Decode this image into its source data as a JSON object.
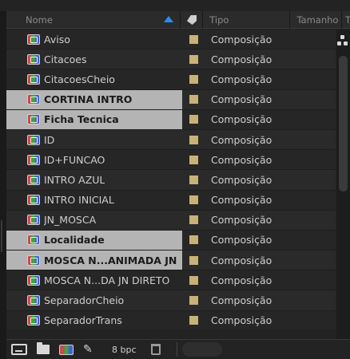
{
  "header": {
    "name_label": "Nome",
    "tipo_label": "Tipo",
    "tamanho_label": "Tamanho",
    "extra_label": "T",
    "sort_direction": "ascending",
    "accent_color": "#2d8ceb"
  },
  "items": [
    {
      "name": "Aviso",
      "type": "Composição",
      "label_color": "#c9b17a",
      "selected": false,
      "bold": false
    },
    {
      "name": "Citacoes",
      "type": "Composição",
      "label_color": "#c9b17a",
      "selected": false,
      "bold": false
    },
    {
      "name": "CitacoesCheio",
      "type": "Composição",
      "label_color": "#c9b17a",
      "selected": false,
      "bold": false
    },
    {
      "name": "CORTINA INTRO",
      "type": "Composição",
      "label_color": "#c9b17a",
      "selected": true,
      "bold": true
    },
    {
      "name": "Ficha Tecnica",
      "type": "Composição",
      "label_color": "#c9b17a",
      "selected": true,
      "bold": true
    },
    {
      "name": "ID",
      "type": "Composição",
      "label_color": "#c9b17a",
      "selected": false,
      "bold": false
    },
    {
      "name": "ID+FUNCAO",
      "type": "Composição",
      "label_color": "#c9b17a",
      "selected": false,
      "bold": false
    },
    {
      "name": "INTRO AZUL",
      "type": "Composição",
      "label_color": "#c9b17a",
      "selected": false,
      "bold": false
    },
    {
      "name": "INTRO INICIAL",
      "type": "Composição",
      "label_color": "#c9b17a",
      "selected": false,
      "bold": false
    },
    {
      "name": "JN_MOSCA",
      "type": "Composição",
      "label_color": "#c9b17a",
      "selected": false,
      "bold": false
    },
    {
      "name": "Localidade",
      "type": "Composição",
      "label_color": "#c9b17a",
      "selected": true,
      "bold": true
    },
    {
      "name": "MOSCA N...ANIMADA JN",
      "type": "Composição",
      "label_color": "#c9b17a",
      "selected": true,
      "bold": true
    },
    {
      "name": "MOSCA N...DA JN DIRETO",
      "type": "Composição",
      "label_color": "#c9b17a",
      "selected": false,
      "bold": false
    },
    {
      "name": "SeparadorCheio",
      "type": "Composição",
      "label_color": "#c9b17a",
      "selected": false,
      "bold": false
    },
    {
      "name": "SeparadorTrans",
      "type": "Composição",
      "label_color": "#c9b17a",
      "selected": false,
      "bold": false
    }
  ],
  "footer": {
    "bpc_label": "8 bpc",
    "icons": [
      "interpret-footage-icon",
      "new-folder-icon",
      "new-composition-icon",
      "flowchart-pen-icon",
      "trash-icon"
    ]
  }
}
